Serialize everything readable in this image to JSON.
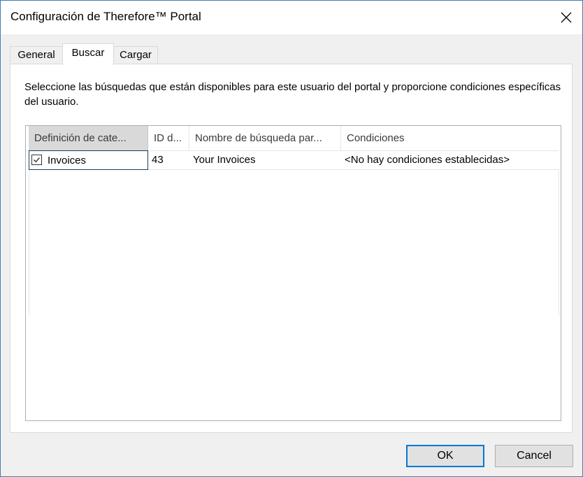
{
  "window": {
    "title": "Configuración de Therefore™ Portal",
    "close_icon": "close-icon"
  },
  "tabs": [
    {
      "label": "General",
      "active": false
    },
    {
      "label": "Buscar",
      "active": true
    },
    {
      "label": "Cargar",
      "active": false
    }
  ],
  "panel": {
    "description": "Seleccione las búsquedas que están disponibles para este usuario del portal y proporcione condiciones específicas del usuario."
  },
  "listview": {
    "columns": [
      "Definición de cate...",
      "ID d...",
      "Nombre de búsqueda par...",
      "Condiciones"
    ],
    "rows": [
      {
        "checked": true,
        "category": "Invoices",
        "id": "43",
        "search_name": "Your Invoices",
        "conditions": "<No hay condiciones establecidas>"
      }
    ]
  },
  "buttons": {
    "ok": "OK",
    "cancel": "Cancel"
  }
}
